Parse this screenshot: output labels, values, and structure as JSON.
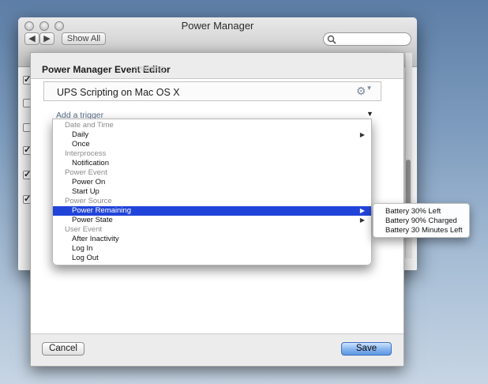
{
  "window": {
    "title": "Power Manager",
    "toolbar": {
      "back_icon": "left-arrow-icon",
      "forward_icon": "right-arrow-icon",
      "show_all_label": "Show All",
      "search_placeholder": ""
    },
    "checkbox_states": [
      true,
      false,
      false,
      true,
      true,
      true
    ]
  },
  "sheet": {
    "title": "Power Manager Event Editor",
    "ghost_text": "amming",
    "event_name": "UPS Scripting on Mac OS X",
    "trigger_placeholder": "Add a trigger",
    "cancel_label": "Cancel",
    "save_label": "Save"
  },
  "menu": {
    "items": [
      {
        "type": "group",
        "label": "Date and Time"
      },
      {
        "type": "item",
        "label": "Daily",
        "submenu": true
      },
      {
        "type": "item",
        "label": "Once"
      },
      {
        "type": "group",
        "label": "Interprocess"
      },
      {
        "type": "item",
        "label": "Notification"
      },
      {
        "type": "group",
        "label": "Power Event"
      },
      {
        "type": "item",
        "label": "Power On"
      },
      {
        "type": "item",
        "label": "Start Up"
      },
      {
        "type": "group",
        "label": "Power Source"
      },
      {
        "type": "item",
        "label": "Power Remaining",
        "submenu": true,
        "selected": true
      },
      {
        "type": "item",
        "label": "Power State",
        "submenu": true
      },
      {
        "type": "group",
        "label": "User Event"
      },
      {
        "type": "item",
        "label": "After Inactivity"
      },
      {
        "type": "item",
        "label": "Log In"
      },
      {
        "type": "item",
        "label": "Log Out"
      }
    ],
    "submenu_items": [
      "Battery 30% Left",
      "Battery 90% Charged",
      "Battery 30 Minutes Left"
    ]
  }
}
